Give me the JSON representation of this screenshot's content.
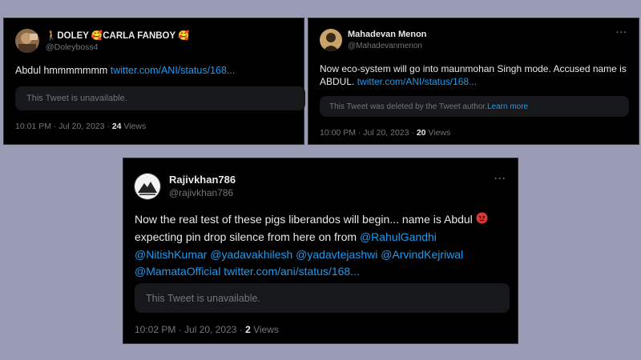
{
  "tweets": [
    {
      "name": "🚶DOLEY 🥰CARLA FANBOY 🥰",
      "handle": "@Doleyboss4",
      "text": "Abdul hmmmmmmm ",
      "link": "twitter.com/ANI/status/168...",
      "quote": "This Tweet is unavailable.",
      "time": "10:01 PM · Jul 20, 2023 · ",
      "views_count": "24",
      "views_label": " Views"
    },
    {
      "name": "Mahadevan Menon",
      "handle": "@Mahadevanmenon",
      "more": "···",
      "text": "Now eco-system will go into maunmohan Singh mode. Accused name is ABDUL. ",
      "link": "twitter.com/ANI/status/168...",
      "quote": "This Tweet was deleted by the Tweet author. ",
      "quote_link": "Learn more",
      "time": "10:00 PM · Jul 20, 2023 · ",
      "views_count": "20",
      "views_label": " Views"
    },
    {
      "name": "Rajivkhan786",
      "handle": "@rajivkhan786",
      "more": "···",
      "text": "Now the real test of these pigs liberandos will begin... name is Abdul ",
      "text2": " expecting pin drop silence from here on from ",
      "mentions": [
        "@RahulGandhi",
        "@NitishKumar",
        "@yadavakhilesh",
        "@yadavtejashwi",
        "@ArvindKejriwal",
        "@MamataOfficial"
      ],
      "link": "twitter.com/ani/status/168...",
      "quote": "This Tweet is unavailable.",
      "time": "10:02 PM · Jul 20, 2023 · ",
      "views_count": "2",
      "views_label": " Views"
    }
  ],
  "colors": {
    "background": "#9a9cb6",
    "card": "#000000",
    "link": "#1d9bf0",
    "muted": "#71767b"
  },
  "icons": [
    "avatar-photo",
    "angry-face-emoji",
    "more-options-icon"
  ]
}
